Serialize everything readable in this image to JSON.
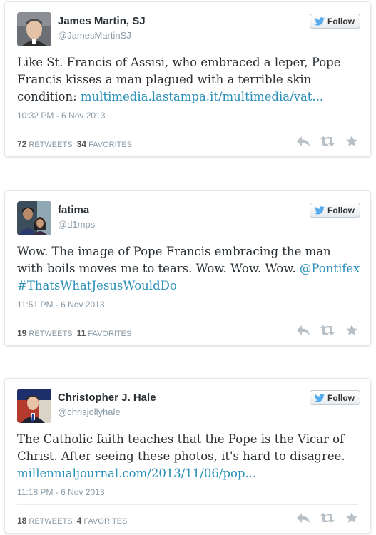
{
  "follow_label": "Follow",
  "tweets": [
    {
      "name": "James Martin, SJ",
      "handle": "@JamesMartinSJ",
      "text_plain": "Like St. Francis of Assisi, who embraced a leper, Pope Francis kisses a man plagued with a terrible skin condition: ",
      "link": "multimedia.lastampa.it/multimedia/vat...",
      "time": "10:32 PM - 6 Nov 2013",
      "retweets": "72",
      "retweets_label": "RETWEETS",
      "favorites": "34",
      "favorites_label": "FAVORITES"
    },
    {
      "name": "fatima",
      "handle": "@d1mps",
      "text_plain": "Wow. The image of Pope Francis embracing the man with boils moves me to tears. Wow. Wow. Wow. ",
      "mention": "@Pontifex",
      "hashtag": "#ThatsWhatJesusWouldDo",
      "time": "11:51 PM - 6 Nov 2013",
      "retweets": "19",
      "retweets_label": "RETWEETS",
      "favorites": "11",
      "favorites_label": "FAVORITES"
    },
    {
      "name": "Christopher J. Hale",
      "handle": "@chrisjollyhale",
      "text_plain": "The Catholic faith teaches that the Pope is the Vicar of Christ. After seeing these photos, it's hard to disagree. ",
      "link": "millennialjournal.com/2013/11/06/pop...",
      "time": "11:18 PM - 6 Nov 2013",
      "retweets": "18",
      "retweets_label": "RETWEETS",
      "favorites": "4",
      "favorites_label": "FAVORITES"
    }
  ],
  "colors": {
    "link": "#2b8fb7",
    "twitter_bird": "#55acee",
    "muted": "#8899a6",
    "action_icon": "#b8c1c8"
  },
  "icons": [
    "twitter-bird-icon",
    "reply-icon",
    "retweet-icon",
    "favorite-star-icon"
  ]
}
